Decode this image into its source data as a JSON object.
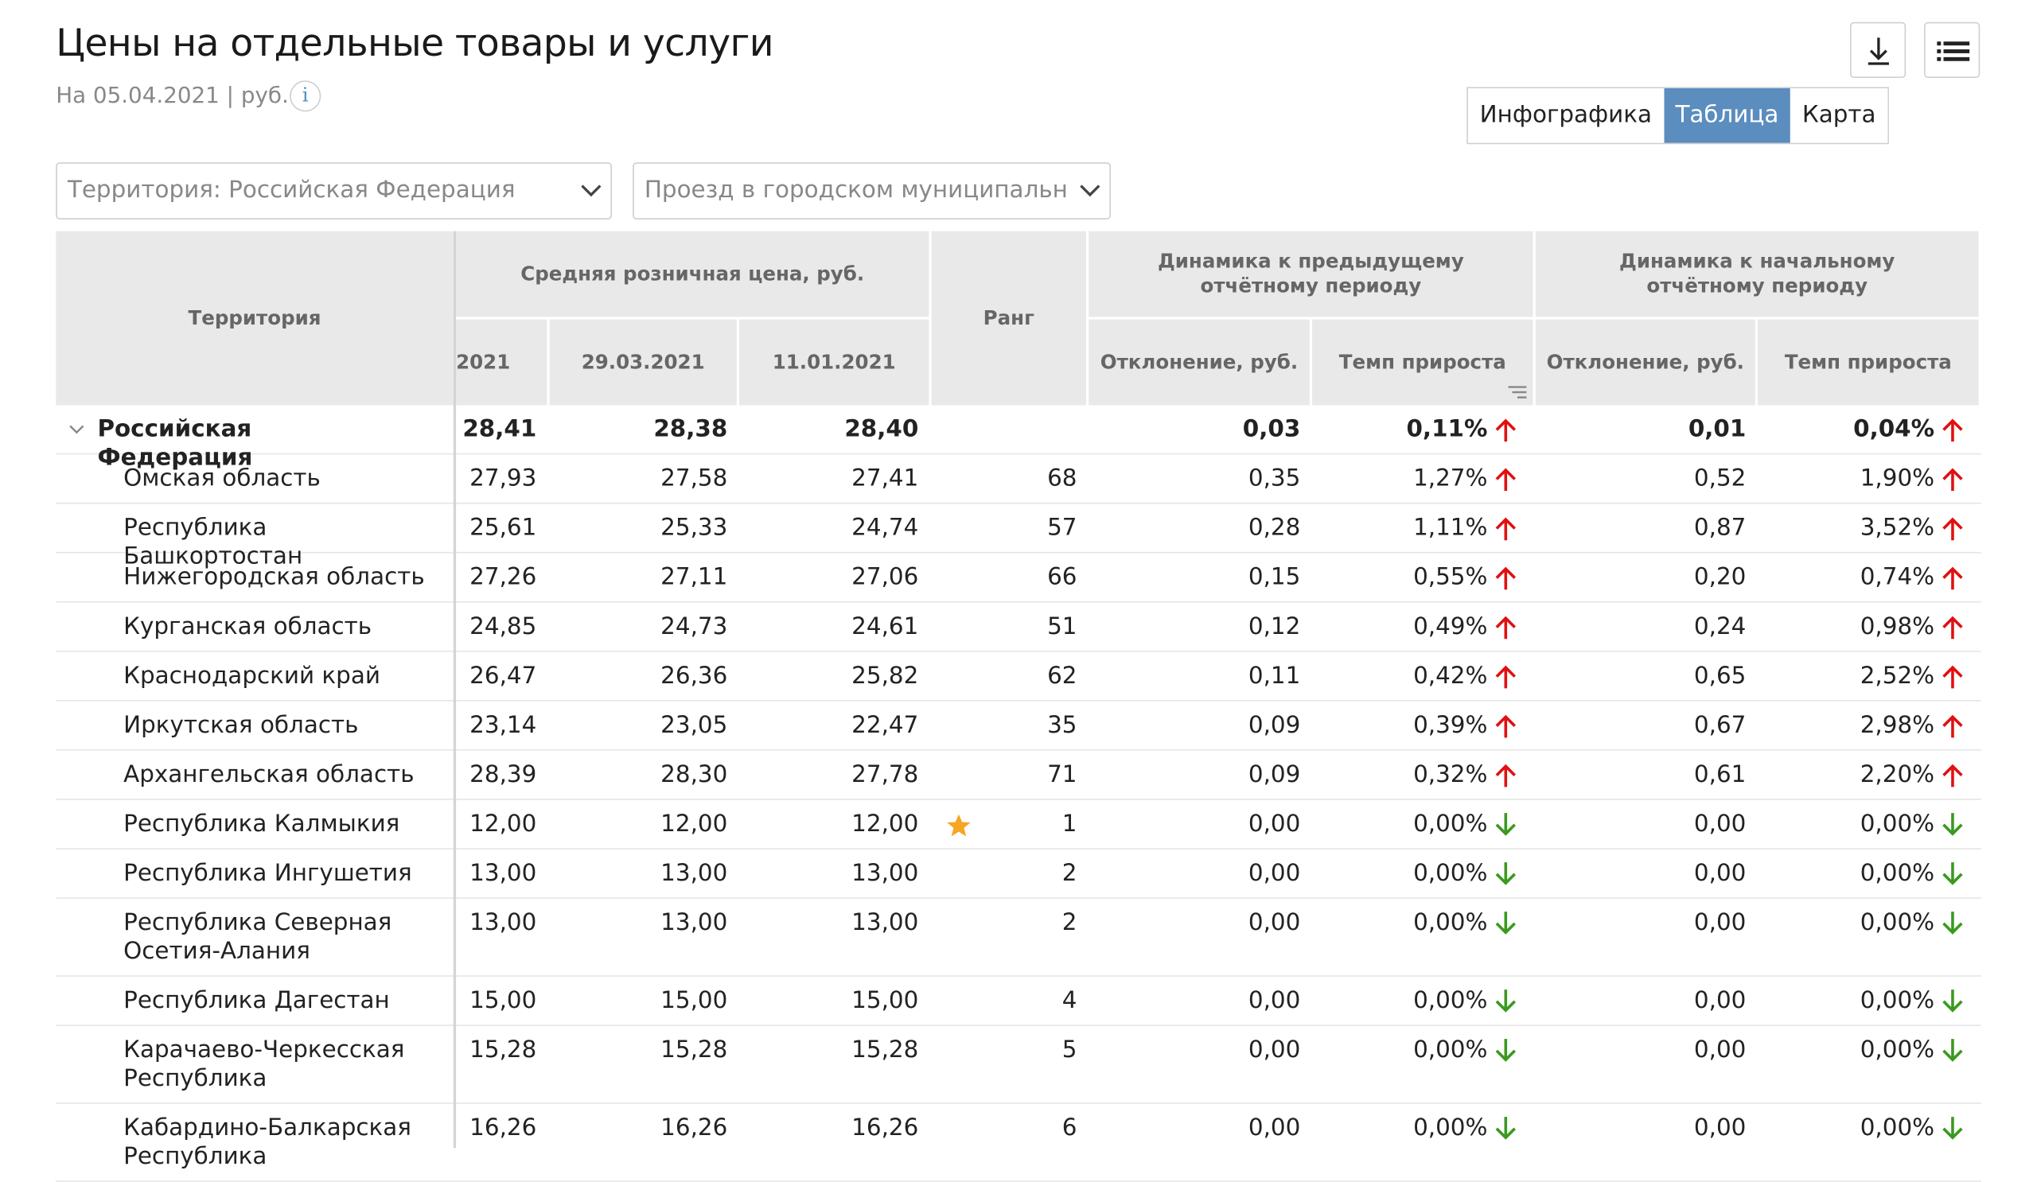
{
  "page": {
    "title": "Цены на отдельные товары и услуги",
    "subtitle": "На 05.04.2021 | руб.",
    "info_icon": "i"
  },
  "toolbar": {
    "download_icon": "download-icon",
    "list_icon": "list-icon"
  },
  "view_tabs": [
    {
      "label": "Инфографика",
      "active": false
    },
    {
      "label": "Таблица",
      "active": true
    },
    {
      "label": "Карта",
      "active": false
    }
  ],
  "filters": {
    "territory": "Территория: Российская  Федерация",
    "service": "Проезд в городском муниципальном"
  },
  "colors": {
    "accent": "#5b8dbf",
    "up_arrow": "#e01010",
    "down_arrow": "#3a9a1e",
    "star": "#f5a623"
  },
  "table": {
    "headers": {
      "territory": "Территория",
      "avg_price": "Средняя розничная цена, руб.",
      "rank": "Ранг",
      "prev_period": "Динамика к предыдущему отчётному периоду",
      "initial_period": "Динамика к начальному отчётному периоду",
      "date1": "2021",
      "date2": "29.03.2021",
      "date3": "11.01.2021",
      "dev_prev": "Отклонение, руб.",
      "growth_prev": "Темп прироста",
      "dev_init": "Отклонение, руб.",
      "growth_init": "Темп прироста"
    },
    "rows": [
      {
        "name": "Российская Федерация",
        "bold": true,
        "expanded": true,
        "p1": "28,41",
        "p2": "28,38",
        "p3": "28,40",
        "rank": "",
        "dev1": "0,03",
        "g1": "0,11%",
        "d1": "up",
        "dev2": "0,01",
        "g2": "0,04%",
        "d2": "up"
      },
      {
        "name": "Омская область",
        "p1": "27,93",
        "p2": "27,58",
        "p3": "27,41",
        "rank": "68",
        "dev1": "0,35",
        "g1": "1,27%",
        "d1": "up",
        "dev2": "0,52",
        "g2": "1,90%",
        "d2": "up"
      },
      {
        "name": "Республика Башкортостан",
        "p1": "25,61",
        "p2": "25,33",
        "p3": "24,74",
        "rank": "57",
        "dev1": "0,28",
        "g1": "1,11%",
        "d1": "up",
        "dev2": "0,87",
        "g2": "3,52%",
        "d2": "up"
      },
      {
        "name": "Нижегородская область",
        "p1": "27,26",
        "p2": "27,11",
        "p3": "27,06",
        "rank": "66",
        "dev1": "0,15",
        "g1": "0,55%",
        "d1": "up",
        "dev2": "0,20",
        "g2": "0,74%",
        "d2": "up"
      },
      {
        "name": "Курганская область",
        "p1": "24,85",
        "p2": "24,73",
        "p3": "24,61",
        "rank": "51",
        "dev1": "0,12",
        "g1": "0,49%",
        "d1": "up",
        "dev2": "0,24",
        "g2": "0,98%",
        "d2": "up"
      },
      {
        "name": "Краснодарский край",
        "p1": "26,47",
        "p2": "26,36",
        "p3": "25,82",
        "rank": "62",
        "dev1": "0,11",
        "g1": "0,42%",
        "d1": "up",
        "dev2": "0,65",
        "g2": "2,52%",
        "d2": "up"
      },
      {
        "name": "Иркутская область",
        "p1": "23,14",
        "p2": "23,05",
        "p3": "22,47",
        "rank": "35",
        "dev1": "0,09",
        "g1": "0,39%",
        "d1": "up",
        "dev2": "0,67",
        "g2": "2,98%",
        "d2": "up"
      },
      {
        "name": "Архангельская область",
        "p1": "28,39",
        "p2": "28,30",
        "p3": "27,78",
        "rank": "71",
        "dev1": "0,09",
        "g1": "0,32%",
        "d1": "up",
        "dev2": "0,61",
        "g2": "2,20%",
        "d2": "up"
      },
      {
        "name": "Республика Калмыкия",
        "star": true,
        "p1": "12,00",
        "p2": "12,00",
        "p3": "12,00",
        "rank": "1",
        "dev1": "0,00",
        "g1": "0,00%",
        "d1": "down",
        "dev2": "0,00",
        "g2": "0,00%",
        "d2": "down"
      },
      {
        "name": "Республика Ингушетия",
        "p1": "13,00",
        "p2": "13,00",
        "p3": "13,00",
        "rank": "2",
        "dev1": "0,00",
        "g1": "0,00%",
        "d1": "down",
        "dev2": "0,00",
        "g2": "0,00%",
        "d2": "down"
      },
      {
        "name": "Республика Северная Осетия-Алания",
        "tall": true,
        "p1": "13,00",
        "p2": "13,00",
        "p3": "13,00",
        "rank": "2",
        "dev1": "0,00",
        "g1": "0,00%",
        "d1": "down",
        "dev2": "0,00",
        "g2": "0,00%",
        "d2": "down"
      },
      {
        "name": "Республика Дагестан",
        "p1": "15,00",
        "p2": "15,00",
        "p3": "15,00",
        "rank": "4",
        "dev1": "0,00",
        "g1": "0,00%",
        "d1": "down",
        "dev2": "0,00",
        "g2": "0,00%",
        "d2": "down"
      },
      {
        "name": "Карачаево-Черкесская Республика",
        "tall": true,
        "p1": "15,28",
        "p2": "15,28",
        "p3": "15,28",
        "rank": "5",
        "dev1": "0,00",
        "g1": "0,00%",
        "d1": "down",
        "dev2": "0,00",
        "g2": "0,00%",
        "d2": "down"
      },
      {
        "name": "Кабардино-Балкарская Республика",
        "tall": true,
        "p1": "16,26",
        "p2": "16,26",
        "p3": "16,26",
        "rank": "6",
        "dev1": "0,00",
        "g1": "0,00%",
        "d1": "down",
        "dev2": "0,00",
        "g2": "0,00%",
        "d2": "down"
      }
    ]
  }
}
